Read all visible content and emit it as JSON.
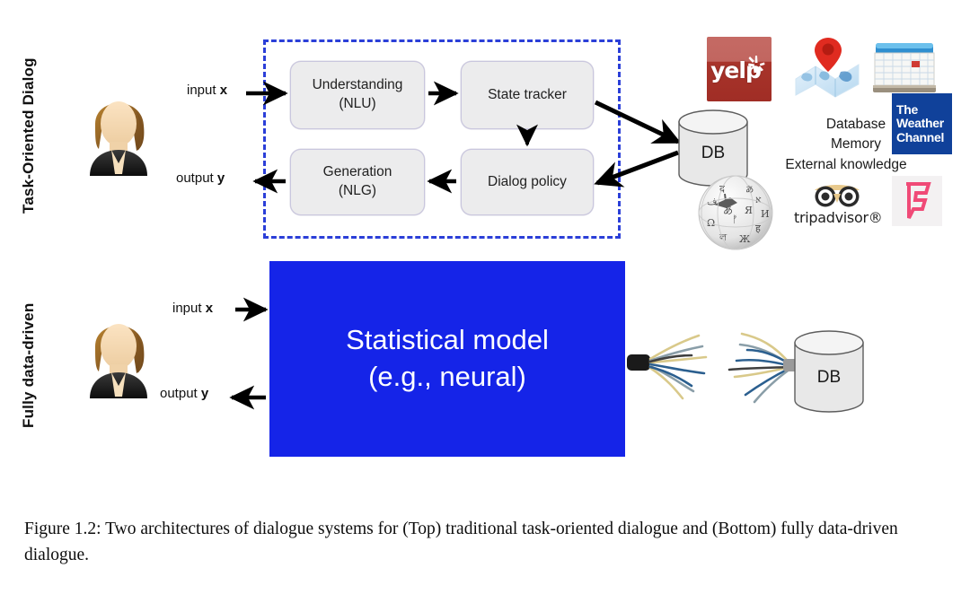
{
  "rows": {
    "top_label": "Task-Oriented Dialog",
    "bottom_label": "Fully data-driven"
  },
  "io": {
    "input_prefix": "input ",
    "input_var": "x",
    "output_prefix": "output ",
    "output_var": "y"
  },
  "pipeline": {
    "nlu_line1": "Understanding",
    "nlu_line2": "(NLU)",
    "state_tracker": "State tracker",
    "dialog_policy": "Dialog policy",
    "nlg_line1": "Generation",
    "nlg_line2": "(NLG)"
  },
  "model": {
    "line1": "Statistical model",
    "line2": "(e.g., neural)"
  },
  "db": {
    "top_label": "DB",
    "bottom_label": "DB"
  },
  "knowledge": {
    "line1": "Database",
    "line2": "Memory",
    "line3": "External knowledge"
  },
  "logos": {
    "yelp": "yelp",
    "weather_l1": "The",
    "weather_l2": "Weather",
    "weather_l3": "Channel",
    "tripadvisor": "tripadvisor®",
    "map": "map-pin-icon",
    "calendar": "calendar-icon",
    "wikipedia": "wikipedia-globe-icon",
    "foursquare": "foursquare-icon"
  },
  "caption": {
    "text": "Figure 1.2: Two architectures of dialogue systems for (Top) traditional task-oriented dialogue and (Bottom) fully data-driven dialogue."
  },
  "colors": {
    "model_blue": "#1524e8",
    "dashed_border": "#2b3fd8",
    "box_fill": "#ececed",
    "yelp_red": "#a8342b",
    "weather_blue": "#10419a",
    "foursquare_pink": "#f04a77"
  }
}
